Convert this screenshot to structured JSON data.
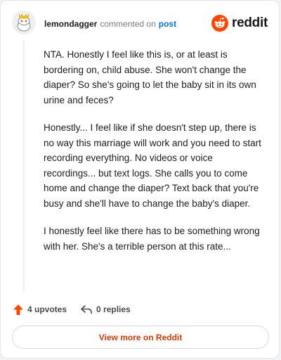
{
  "header": {
    "username": "lemondagger",
    "action_text": "commented on",
    "post_link": "post",
    "brand": "reddit",
    "avatar_icon": "snoo-avatar-icon",
    "brand_icon": "reddit-logo-icon"
  },
  "comment": {
    "paragraphs": [
      "NTA. Honestly I feel like this is, or at least is bordering on, child abuse. She won't change the diaper? So she's going to let the baby sit in its own urine and feces?",
      "Honestly... I feel like if she doesn't step up, there is no way this marriage will work and you need to start recording everything. No videos or voice recordings... but text logs. She calls you to come home and change the diaper? Text back that you're busy and she'll have to change the baby's diaper.",
      "I honestly feel like there has to be something wrong with her. She's a terrible person at this rate..."
    ]
  },
  "actions": {
    "upvotes": "4 upvotes",
    "replies": "0 replies",
    "upvote_icon": "upvote-arrow-icon",
    "reply_icon": "reply-arrow-icon"
  },
  "footer": {
    "view_button": "View more on Reddit"
  },
  "colors": {
    "accent": "#d93a00",
    "reddit_orange": "#ff4500",
    "link_blue": "#0079d3",
    "text": "#1c1c1c",
    "muted": "#7c7c7c"
  }
}
